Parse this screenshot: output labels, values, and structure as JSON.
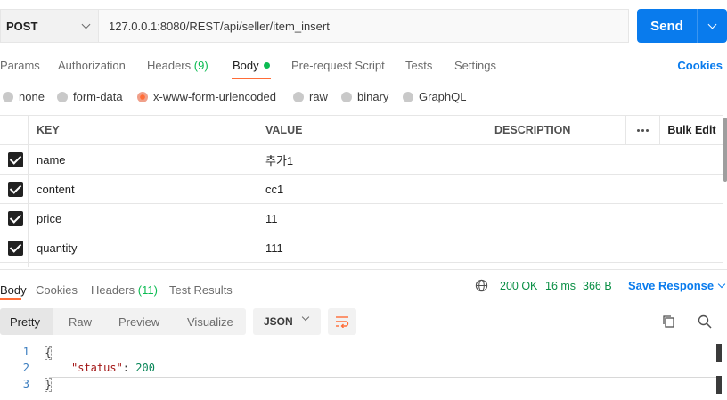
{
  "request": {
    "method": "POST",
    "url": "127.0.0.1:8080/REST/api/seller/item_insert",
    "send_label": "Send"
  },
  "request_tabs": {
    "params": "Params",
    "authorization": "Authorization",
    "headers": "Headers",
    "headers_count": "(9)",
    "body": "Body",
    "prerequest": "Pre-request Script",
    "tests": "Tests",
    "settings": "Settings",
    "cookies": "Cookies"
  },
  "body_types": {
    "none": "none",
    "form_data": "form-data",
    "urlencoded": "x-www-form-urlencoded",
    "raw": "raw",
    "binary": "binary",
    "graphql": "GraphQL",
    "selected": "x-www-form-urlencoded"
  },
  "table": {
    "headers": {
      "key": "KEY",
      "value": "VALUE",
      "description": "DESCRIPTION",
      "bulk_edit": "Bulk Edit"
    },
    "rows": [
      {
        "checked": true,
        "key": "name",
        "value": "추가1",
        "description": ""
      },
      {
        "checked": true,
        "key": "content",
        "value": "cc1",
        "description": ""
      },
      {
        "checked": true,
        "key": "price",
        "value": "11",
        "description": ""
      },
      {
        "checked": true,
        "key": "quantity",
        "value": "111",
        "description": ""
      }
    ]
  },
  "response_tabs": {
    "body": "Body",
    "cookies": "Cookies",
    "headers": "Headers",
    "headers_count": "(11)",
    "test_results": "Test Results"
  },
  "response_meta": {
    "status": "200 OK",
    "time": "16 ms",
    "size": "366 B",
    "save_response": "Save Response"
  },
  "view": {
    "pretty": "Pretty",
    "raw": "Raw",
    "preview": "Preview",
    "visualize": "Visualize",
    "format": "JSON"
  },
  "code": {
    "line_numbers": [
      "1",
      "2",
      "3"
    ],
    "open": "{",
    "key": "\"status\"",
    "sep": ": ",
    "value": "200",
    "close": "}"
  },
  "colors": {
    "accent_orange": "#ff6c37",
    "brand_blue": "#097bed",
    "status_green": "#0a8f45"
  },
  "icons": [
    "chevron-down-icon",
    "globe-icon",
    "wrap-lines-icon",
    "copy-icon",
    "search-icon",
    "more-dots-icon",
    "checkbox-checked-icon"
  ]
}
